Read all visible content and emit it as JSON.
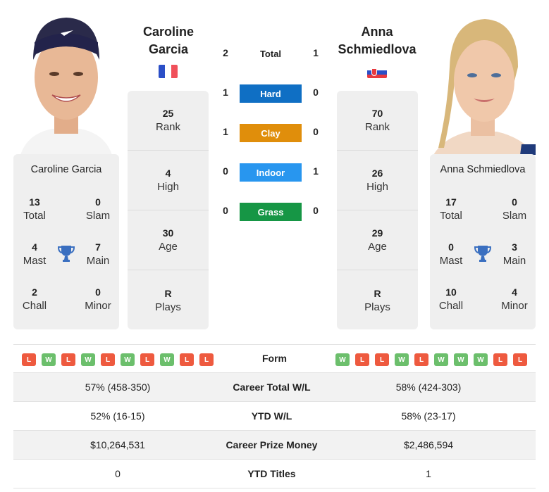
{
  "players": {
    "left": {
      "name_line1": "Caroline",
      "name_line2": "Garcia",
      "full_name": "Caroline Garcia",
      "country_flag": "france-flag",
      "rank": "25",
      "rank_label": "Rank",
      "high": "4",
      "high_label": "High",
      "age": "30",
      "age_label": "Age",
      "plays": "R",
      "plays_label": "Plays",
      "titles": {
        "total": "13",
        "total_label": "Total",
        "slam": "0",
        "slam_label": "Slam",
        "mast": "4",
        "mast_label": "Mast",
        "main": "7",
        "main_label": "Main",
        "chall": "2",
        "chall_label": "Chall",
        "minor": "0",
        "minor_label": "Minor"
      }
    },
    "right": {
      "name_line1": "Anna",
      "name_line2": "Schmiedlova",
      "full_name": "Anna Schmiedlova",
      "country_flag": "slovakia-flag",
      "rank": "70",
      "rank_label": "Rank",
      "high": "26",
      "high_label": "High",
      "age": "29",
      "age_label": "Age",
      "plays": "R",
      "plays_label": "Plays",
      "titles": {
        "total": "17",
        "total_label": "Total",
        "slam": "0",
        "slam_label": "Slam",
        "mast": "0",
        "mast_label": "Mast",
        "main": "3",
        "main_label": "Main",
        "chall": "10",
        "chall_label": "Chall",
        "minor": "4",
        "minor_label": "Minor"
      }
    }
  },
  "h2h": {
    "total": {
      "label": "Total",
      "left": "2",
      "right": "1"
    },
    "surfaces": [
      {
        "label": "Hard",
        "left": "1",
        "right": "0",
        "color": "#0f6fc4"
      },
      {
        "label": "Clay",
        "left": "1",
        "right": "0",
        "color": "#e08e0b"
      },
      {
        "label": "Indoor",
        "left": "0",
        "right": "1",
        "color": "#2896ef"
      },
      {
        "label": "Grass",
        "left": "0",
        "right": "0",
        "color": "#169645"
      }
    ]
  },
  "form": {
    "label": "Form",
    "left": [
      "L",
      "W",
      "L",
      "W",
      "L",
      "W",
      "L",
      "W",
      "L",
      "L"
    ],
    "right": [
      "W",
      "L",
      "L",
      "W",
      "L",
      "W",
      "W",
      "W",
      "L",
      "L"
    ]
  },
  "stats": [
    {
      "label": "Career Total W/L",
      "left": "57% (458-350)",
      "right": "58% (424-303)"
    },
    {
      "label": "YTD W/L",
      "left": "52% (16-15)",
      "right": "58% (23-17)"
    },
    {
      "label": "Career Prize Money",
      "left": "$10,264,531",
      "right": "$2,486,594"
    },
    {
      "label": "YTD Titles",
      "left": "0",
      "right": "1"
    }
  ]
}
